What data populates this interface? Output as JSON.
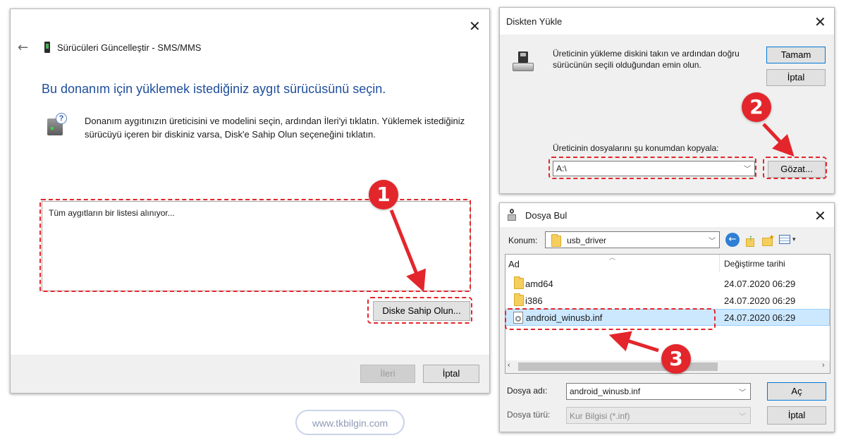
{
  "left_window": {
    "title": "Sürücüleri Güncelleştir - SMS/MMS",
    "heading": "Bu donanım için yüklemek istediğiniz aygıt sürücüsünü seçin.",
    "description_line1": "Donanım aygıtınızın üreticisini ve modelini seçin, ardından İleri'yi tıklatın. Yüklemek istediğiniz",
    "description_line2": "sürücüyü içeren bir diskiniz varsa, Disk'e Sahip Olun seçeneğini tıklatın.",
    "list_status": "Tüm aygıtların bir listesi alınıyor...",
    "have_disk_button": "Diske Sahip Olun...",
    "next_button": "İleri",
    "cancel_button": "İptal"
  },
  "disk_dialog": {
    "title": "Diskten Yükle",
    "message_line1": "Üreticinin yükleme diskini takın ve ardından doğru",
    "message_line2": "sürücünün seçili olduğundan emin olun.",
    "ok_button": "Tamam",
    "cancel_button": "İptal",
    "copy_label": "Üreticinin dosyalarını şu konumdan kopyala:",
    "path_value": "A:\\",
    "browse_button": "Gözat..."
  },
  "file_dialog": {
    "title": "Dosya Bul",
    "location_label": "Konum:",
    "location_value": "usb_driver",
    "columns": {
      "name": "Ad",
      "modified": "Değiştirme tarihi"
    },
    "rows": [
      {
        "name": "amd64",
        "modified": "24.07.2020 06:29",
        "type": "folder"
      },
      {
        "name": "i386",
        "modified": "24.07.2020 06:29",
        "type": "folder"
      },
      {
        "name": "android_winusb.inf",
        "modified": "24.07.2020 06:29",
        "type": "file"
      }
    ],
    "file_name_label": "Dosya adı:",
    "file_name_value": "android_winusb.inf",
    "file_type_label": "Dosya türü:",
    "file_type_value": "Kur Bilgisi (*.inf)",
    "open_button": "Aç",
    "cancel_button": "İptal"
  },
  "annotations": {
    "step1": "1",
    "step2": "2",
    "step3": "3"
  },
  "watermark": "www.tkbilgin.com",
  "colors": {
    "accent_red": "#e3262b",
    "heading_blue": "#1f4e9c",
    "selection_blue": "#cce8ff"
  }
}
